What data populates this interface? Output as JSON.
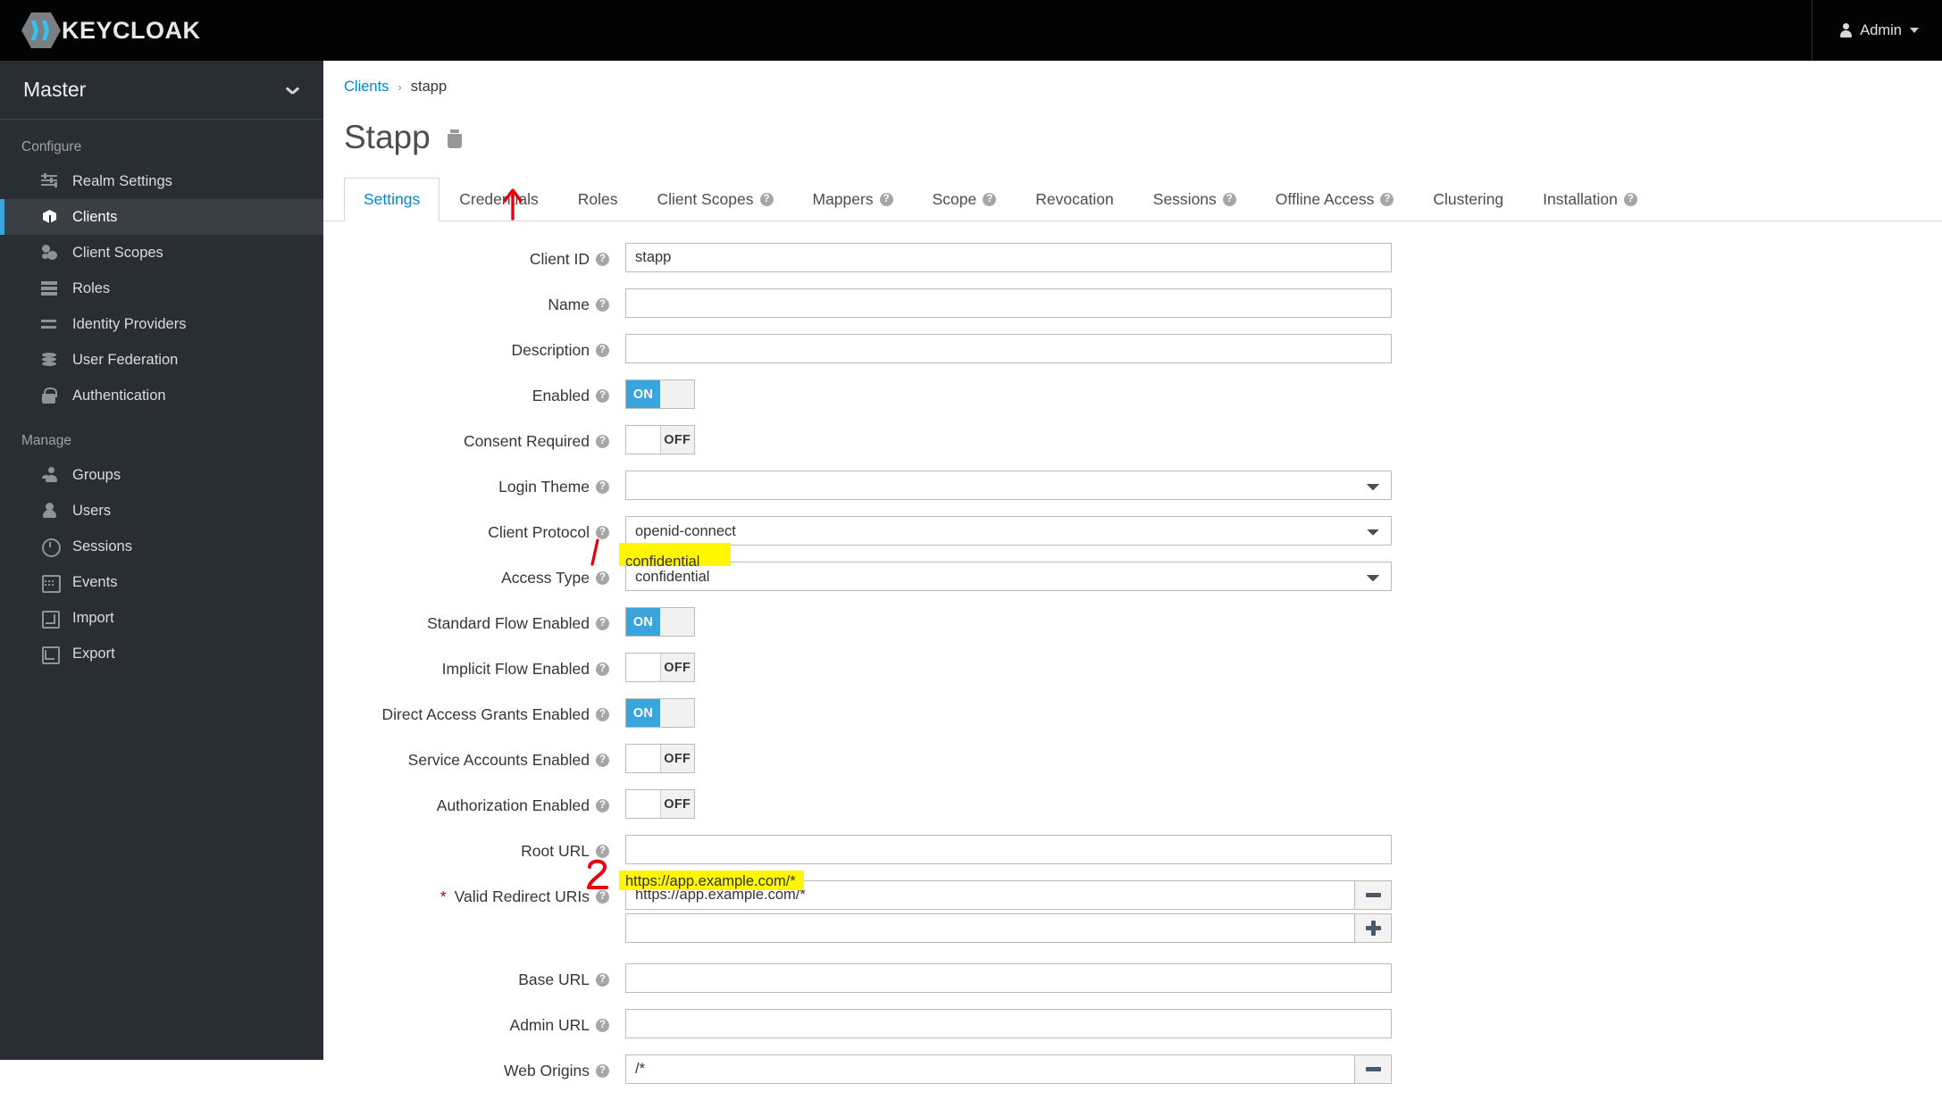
{
  "topbar": {
    "brand_name": "KEYCLOAK",
    "brand_icon": "keycloak-hexagon-logo",
    "user_label": "Admin",
    "user_icon": "user-icon",
    "caret_icon": "chevron-down-icon"
  },
  "sidebar": {
    "realm": "Master",
    "realm_caret_icon": "chevron-down-icon",
    "groups": [
      {
        "title": "Configure",
        "items": [
          {
            "label": "Realm Settings",
            "icon": "sliders-icon",
            "active": false
          },
          {
            "label": "Clients",
            "icon": "cube-icon",
            "active": true
          },
          {
            "label": "Client Scopes",
            "icon": "scopes-icon",
            "active": false
          },
          {
            "label": "Roles",
            "icon": "roles-icon",
            "active": false
          },
          {
            "label": "Identity Providers",
            "icon": "arrows-exchange-icon",
            "active": false
          },
          {
            "label": "User Federation",
            "icon": "database-icon",
            "active": false
          },
          {
            "label": "Authentication",
            "icon": "lock-icon",
            "active": false
          }
        ]
      },
      {
        "title": "Manage",
        "items": [
          {
            "label": "Groups",
            "icon": "groups-icon",
            "active": false
          },
          {
            "label": "Users",
            "icon": "user-icon",
            "active": false
          },
          {
            "label": "Sessions",
            "icon": "clock-icon",
            "active": false
          },
          {
            "label": "Events",
            "icon": "calendar-icon",
            "active": false
          },
          {
            "label": "Import",
            "icon": "import-arrow-icon",
            "active": false
          },
          {
            "label": "Export",
            "icon": "export-arrow-icon",
            "active": false
          }
        ]
      }
    ]
  },
  "breadcrumb": {
    "parent": "Clients",
    "separator": "›",
    "current": "stapp"
  },
  "page": {
    "title": "Stapp",
    "delete_icon": "trash-icon"
  },
  "tabs": [
    {
      "label": "Settings",
      "help": false,
      "active": true
    },
    {
      "label": "Credentials",
      "help": false,
      "active": false
    },
    {
      "label": "Roles",
      "help": false,
      "active": false
    },
    {
      "label": "Client Scopes",
      "help": true,
      "active": false
    },
    {
      "label": "Mappers",
      "help": true,
      "active": false
    },
    {
      "label": "Scope",
      "help": true,
      "active": false
    },
    {
      "label": "Revocation",
      "help": false,
      "active": false
    },
    {
      "label": "Sessions",
      "help": true,
      "active": false
    },
    {
      "label": "Offline Access",
      "help": true,
      "active": false
    },
    {
      "label": "Clustering",
      "help": false,
      "active": false
    },
    {
      "label": "Installation",
      "help": true,
      "active": false
    }
  ],
  "help_glyph": "?",
  "form": {
    "client_id": {
      "label": "Client ID",
      "value": "stapp",
      "type": "text",
      "required": false
    },
    "name": {
      "label": "Name",
      "value": "",
      "type": "text",
      "required": false
    },
    "description": {
      "label": "Description",
      "value": "",
      "type": "text",
      "required": false
    },
    "enabled": {
      "label": "Enabled",
      "value": "ON",
      "type": "toggle",
      "state": "on",
      "on_label": "ON",
      "off_label": "OFF"
    },
    "consent_required": {
      "label": "Consent Required",
      "value": "OFF",
      "type": "toggle",
      "state": "off",
      "on_label": "ON",
      "off_label": "OFF"
    },
    "login_theme": {
      "label": "Login Theme",
      "value": "",
      "type": "select"
    },
    "client_protocol": {
      "label": "Client Protocol",
      "value": "openid-connect",
      "type": "select"
    },
    "access_type": {
      "label": "Access Type",
      "value": "confidential",
      "type": "select",
      "highlighted": true
    },
    "standard_flow": {
      "label": "Standard Flow Enabled",
      "value": "ON",
      "type": "toggle",
      "state": "on",
      "on_label": "ON",
      "off_label": "OFF"
    },
    "implicit_flow": {
      "label": "Implicit Flow Enabled",
      "value": "OFF",
      "type": "toggle",
      "state": "off",
      "on_label": "ON",
      "off_label": "OFF"
    },
    "direct_access": {
      "label": "Direct Access Grants Enabled",
      "value": "ON",
      "type": "toggle",
      "state": "on",
      "on_label": "ON",
      "off_label": "OFF"
    },
    "service_accounts": {
      "label": "Service Accounts Enabled",
      "value": "OFF",
      "type": "toggle",
      "state": "off",
      "on_label": "ON",
      "off_label": "OFF"
    },
    "authorization": {
      "label": "Authorization Enabled",
      "value": "OFF",
      "type": "toggle",
      "state": "off",
      "on_label": "ON",
      "off_label": "OFF"
    },
    "root_url": {
      "label": "Root URL",
      "value": "",
      "type": "text",
      "required": false
    },
    "valid_redirect_uris": {
      "label": "Valid Redirect URIs",
      "required": true,
      "type": "list",
      "values": [
        "https://app.example.com/*",
        ""
      ],
      "highlighted": true,
      "remove_icon": "minus-icon",
      "add_icon": "plus-icon"
    },
    "base_url": {
      "label": "Base URL",
      "value": "",
      "type": "text"
    },
    "admin_url": {
      "label": "Admin URL",
      "value": "",
      "type": "text"
    },
    "web_origins": {
      "label": "Web Origins",
      "type": "list",
      "values": [
        "/*"
      ],
      "remove_icon": "minus-icon"
    }
  },
  "annotations": [
    {
      "id": "arrow-credentials",
      "kind": "arrow-up",
      "target": "Credentials",
      "color": "#e8000d"
    },
    {
      "id": "step-1",
      "kind": "number",
      "text": "1",
      "target": "Access Type",
      "color": "#e8000d"
    },
    {
      "id": "step-2",
      "kind": "number",
      "text": "2",
      "target": "Valid Redirect URIs",
      "color": "#e8000d"
    }
  ],
  "colors": {
    "accent_blue": "#39a5dc",
    "link_blue": "#0088ce",
    "sidebar_bg": "#292e34",
    "topbar_bg": "#030303",
    "highlight_yellow": "#fff600",
    "annotation_red": "#e8000d"
  }
}
